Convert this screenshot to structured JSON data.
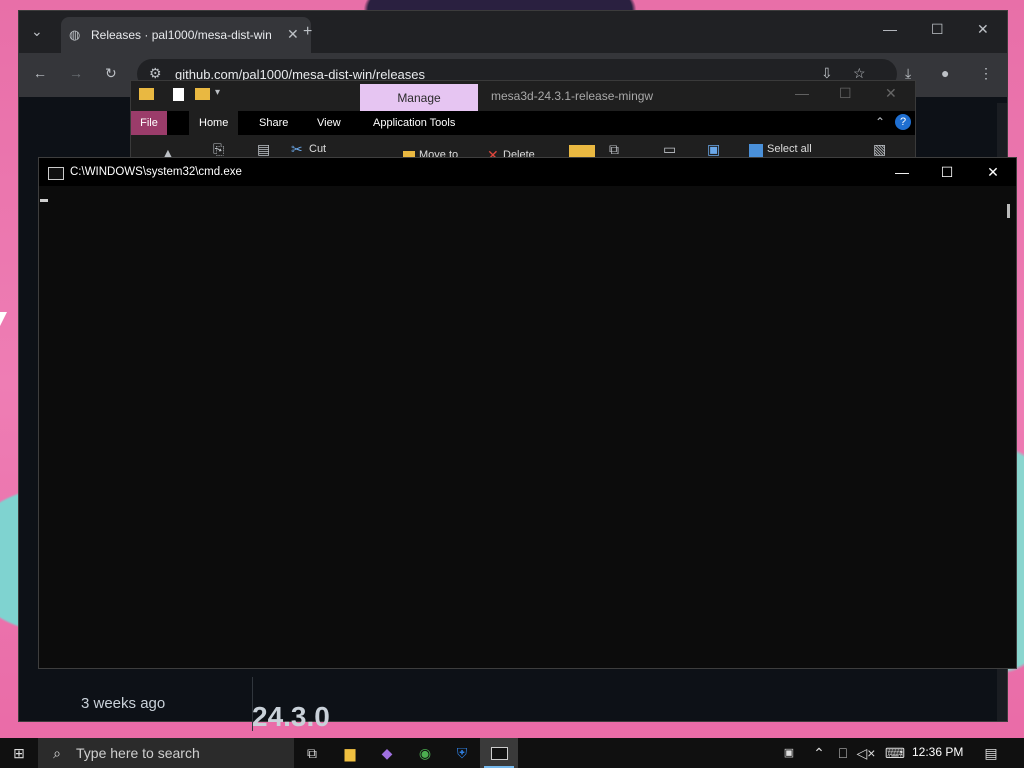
{
  "browser": {
    "tab_title": "Releases · pal1000/mesa-dist-win",
    "url": "github.com/pal1000/mesa-dist-win/releases",
    "release_age": "3 weeks ago",
    "release_version": "24.3.0"
  },
  "explorer": {
    "manage_label": "Manage",
    "window_title": "mesa3d-24.3.1-release-mingw",
    "tabs": [
      "File",
      "Home",
      "Share",
      "View",
      "Application Tools"
    ],
    "ribbon": {
      "cut_label": "Cut",
      "move_to_label": "Move to",
      "delete_label": "Delete",
      "select_all_label": "Select all"
    }
  },
  "cmd": {
    "title": "C:\\WINDOWS\\system32\\cmd.exe"
  },
  "taskbar": {
    "search_placeholder": "Type here to search",
    "clock": "12:36 PM"
  },
  "colors": {
    "file_tab": "#9b3c6a",
    "manage_tab": "#e6c5f2",
    "console_bg": "#0c0c0c"
  }
}
